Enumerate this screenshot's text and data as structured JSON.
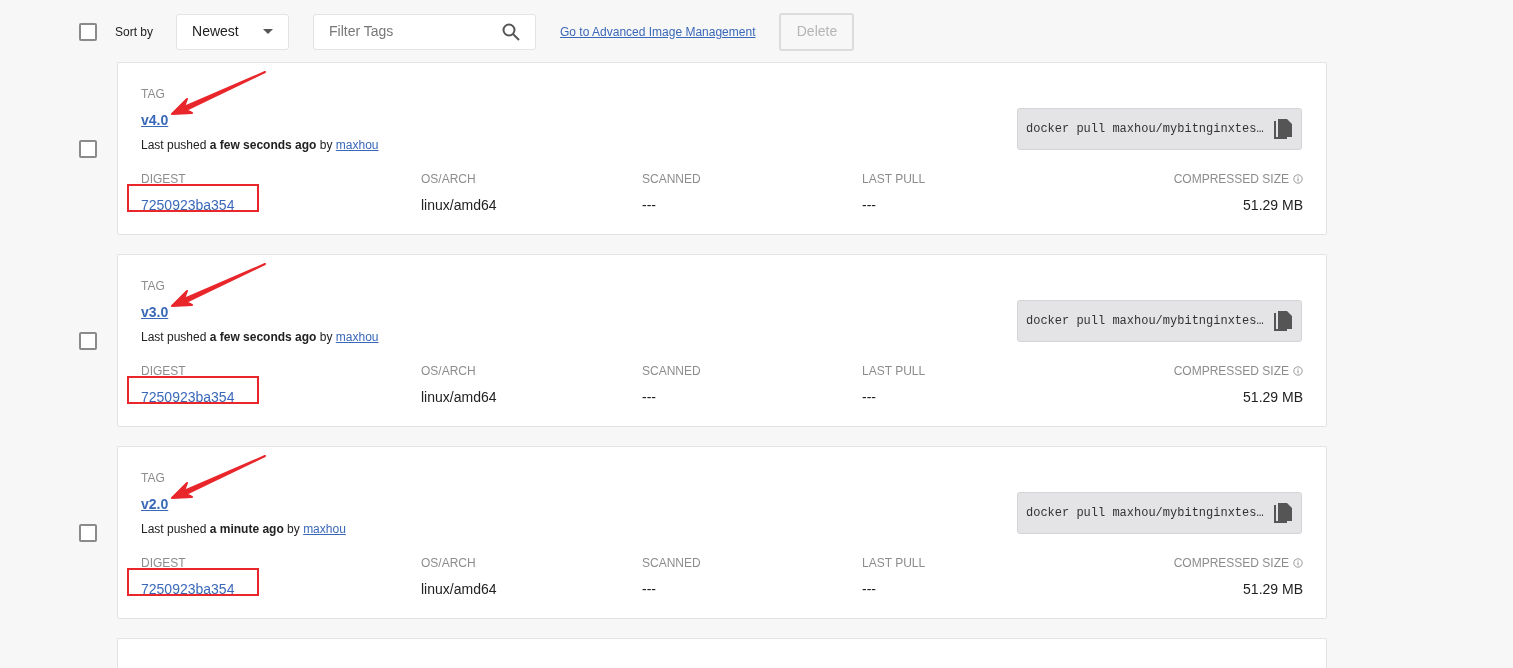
{
  "toolbar": {
    "select_all_checked": false,
    "sort_label": "Sort by",
    "sort_value": "Newest",
    "filter_placeholder": "Filter Tags",
    "advanced_link": "Go to Advanced Image Management",
    "delete_button": {
      "label": "Delete",
      "disabled": true
    }
  },
  "tags": [
    {
      "checked": false,
      "annotated": true,
      "tag_label": "TAG",
      "tag": "v4.0",
      "pushed_prefix": "Last pushed",
      "pushed_when": "a few seconds ago",
      "pushed_by_word": "by",
      "user": "maxhou",
      "command": "docker pull maxhou/mybitnginxtes…",
      "digest_label": "DIGEST",
      "digest": "7250923ba354",
      "os_label": "OS/ARCH",
      "os": "linux/amd64",
      "scanned_label": "SCANNED",
      "scanned": "---",
      "last_pull_label": "LAST PULL",
      "last_pull": "---",
      "size_label": "COMPRESSED SIZE",
      "size": "51.29 MB"
    },
    {
      "checked": false,
      "annotated": true,
      "tag_label": "TAG",
      "tag": "v3.0",
      "pushed_prefix": "Last pushed",
      "pushed_when": "a few seconds ago",
      "pushed_by_word": "by",
      "user": "maxhou",
      "command": "docker pull maxhou/mybitnginxtes…",
      "digest_label": "DIGEST",
      "digest": "7250923ba354",
      "os_label": "OS/ARCH",
      "os": "linux/amd64",
      "scanned_label": "SCANNED",
      "scanned": "---",
      "last_pull_label": "LAST PULL",
      "last_pull": "---",
      "size_label": "COMPRESSED SIZE",
      "size": "51.29 MB"
    },
    {
      "checked": false,
      "annotated": true,
      "tag_label": "TAG",
      "tag": "v2.0",
      "pushed_prefix": "Last pushed",
      "pushed_when": "a minute ago",
      "pushed_by_word": "by",
      "user": "maxhou",
      "command": "docker pull maxhou/mybitnginxtes…",
      "digest_label": "DIGEST",
      "digest": "7250923ba354",
      "os_label": "OS/ARCH",
      "os": "linux/amd64",
      "scanned_label": "SCANNED",
      "scanned": "---",
      "last_pull_label": "LAST PULL",
      "last_pull": "---",
      "size_label": "COMPRESSED SIZE",
      "size": "51.29 MB"
    }
  ],
  "more_below": true
}
